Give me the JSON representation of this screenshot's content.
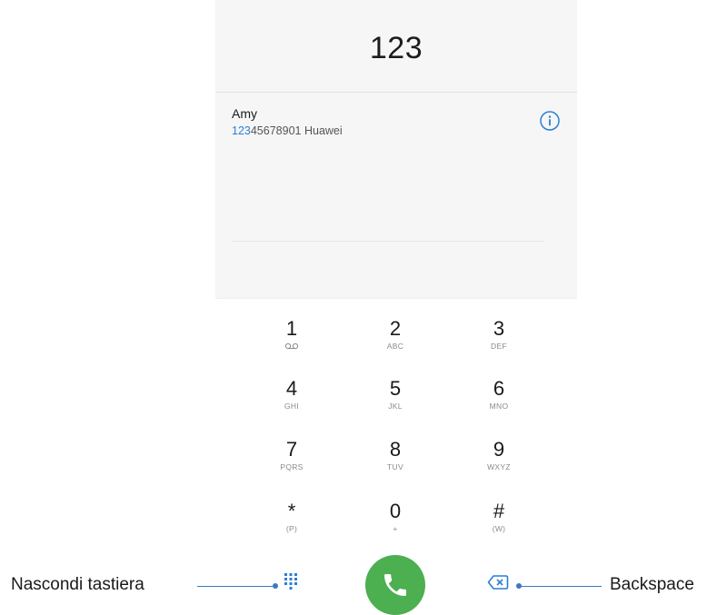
{
  "display": {
    "number": "123"
  },
  "contact_suggestion": {
    "name": "Amy",
    "number_match": "123",
    "number_rest": "45678901",
    "carrier": "Huawei"
  },
  "keypad": [
    {
      "digit": "1",
      "letters": "",
      "icon": "voicemail-icon"
    },
    {
      "digit": "2",
      "letters": "ABC"
    },
    {
      "digit": "3",
      "letters": "DEF"
    },
    {
      "digit": "4",
      "letters": "GHI"
    },
    {
      "digit": "5",
      "letters": "JKL"
    },
    {
      "digit": "6",
      "letters": "MNO"
    },
    {
      "digit": "7",
      "letters": "PQRS"
    },
    {
      "digit": "8",
      "letters": "TUV"
    },
    {
      "digit": "9",
      "letters": "WXYZ"
    },
    {
      "digit": "*",
      "letters": "(P)"
    },
    {
      "digit": "0",
      "letters": "+"
    },
    {
      "digit": "#",
      "letters": "(W)"
    }
  ],
  "actions": {
    "hide_keypad_icon": "dialpad-grid-icon",
    "call_icon": "phone-icon",
    "backspace_icon": "backspace-icon"
  },
  "annotations": {
    "left_label": "Nascondi tastiera",
    "right_label": "Backspace"
  },
  "colors": {
    "accent": "#2a7fd6",
    "call_green": "#4caf50",
    "annotation_line": "#3a78c2",
    "panel_bg": "#f6f6f6"
  }
}
